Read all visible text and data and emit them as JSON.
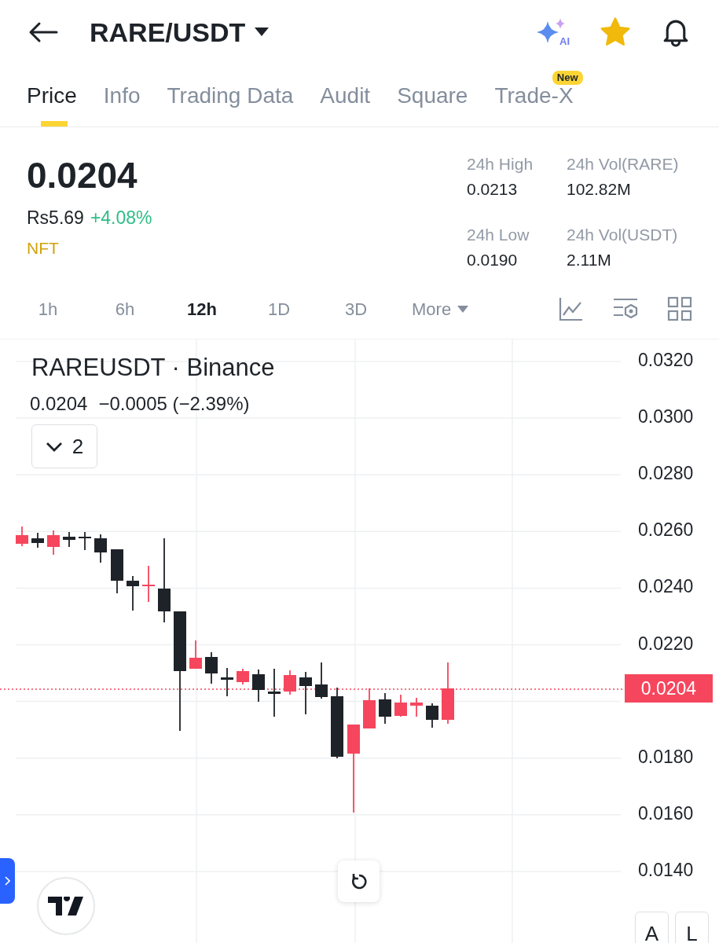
{
  "header": {
    "title": "RARE/USDT",
    "ai_label": "AI",
    "favorite": true
  },
  "tabs": [
    {
      "label": "Price",
      "selected": true
    },
    {
      "label": "Info",
      "selected": false
    },
    {
      "label": "Trading Data",
      "selected": false
    },
    {
      "label": "Audit",
      "selected": false
    },
    {
      "label": "Square",
      "selected": false
    },
    {
      "label": "Trade-X",
      "selected": false,
      "badge": "New"
    }
  ],
  "price": {
    "last": "0.0204",
    "fiat": "Rs5.69",
    "change": "+4.08%",
    "tag": "NFT"
  },
  "stats": [
    {
      "label": "24h High",
      "value": "0.0213"
    },
    {
      "label": "24h Vol(RARE)",
      "value": "102.82M"
    },
    {
      "label": "24h Low",
      "value": "0.0190"
    },
    {
      "label": "24h Vol(USDT)",
      "value": "2.11M"
    }
  ],
  "intervals": [
    {
      "label": "1h",
      "selected": false
    },
    {
      "label": "6h",
      "selected": false
    },
    {
      "label": "12h",
      "selected": true
    },
    {
      "label": "1D",
      "selected": false
    },
    {
      "label": "3D",
      "selected": false
    }
  ],
  "more": "More",
  "chart": {
    "symbol_line": "RAREUSDT · Binance",
    "last": "0.0204",
    "change": "−0.0005 (−2.39%)",
    "indicator_count": "2",
    "y_labels": [
      "0.0320",
      "0.0300",
      "0.0280",
      "0.0260",
      "0.0240",
      "0.0220",
      "0.0180",
      "0.0160",
      "0.0140"
    ],
    "price_badge": "0.0204",
    "scale_buttons": [
      "A",
      "L"
    ]
  }
}
